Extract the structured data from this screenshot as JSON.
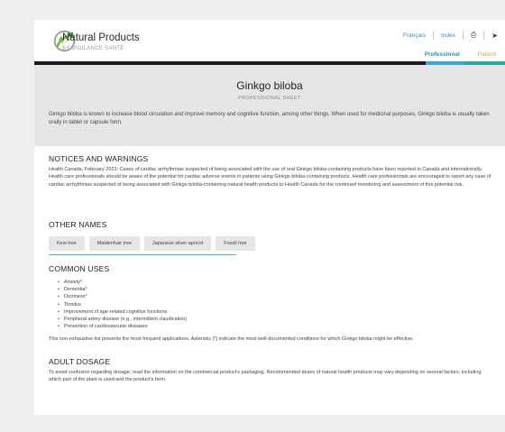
{
  "header": {
    "brand": "Natural Products",
    "tagline": "BY VIGILANCE SANTÉ",
    "links": {
      "language": "Français",
      "index": "Index"
    },
    "tabs": {
      "professional": "Professional",
      "patient": "Patient"
    }
  },
  "hero": {
    "title": "Ginkgo biloba",
    "subtitle": "PROFESSIONAL SHEET",
    "description": "Ginkgo biloba is known to increase blood circulation and improve memory and cognitive function, among other things. When used for medicinal purposes, Ginkgo biloba is usually taken orally in tablet or capsule form."
  },
  "notices": {
    "heading": "NOTICES AND WARNINGS",
    "text": "Health Canada, February 2021: Cases of cardiac arrhythmias suspected of being associated with the use of oral Ginkgo biloba-containing products have been reported in Canada and internationally. Health care professionals should be aware of the potential for cardiac adverse events in patients using Ginkgo biloba-containing products. Health care professionals are encouraged to report any case of cardiac arrhythmias suspected of being associated with Ginkgo biloba-containing natural health products to Health Canada for the continued monitoring and assessment of this potential risk."
  },
  "other_names": {
    "heading": "OTHER NAMES",
    "chips": [
      "Kew tree",
      "Maidenhair tree",
      "Japanese silver apricot",
      "Fossil tree"
    ]
  },
  "common_uses": {
    "heading": "COMMON USES",
    "items": [
      "Anxiety*",
      "Dementia*",
      "Dizziness*",
      "Tinnitus",
      "Improvement of age-related cognitive functions",
      "Peripheral artery disease (e.g., intermittent claudication)",
      "Prevention of cardiovascular diseases"
    ],
    "note": "This non-exhaustive list presents the most frequent applications. Asterisks (*) indicate the most well-documented conditions for which Ginkgo biloba might be effective."
  },
  "adult_dosage": {
    "heading": "ADULT DOSAGE",
    "text": "To avoid confusion regarding dosage, read the information on the commercial product's packaging. Recommended doses of natural health products may vary depending on several factors, including which part of the plant is used and the product's form."
  },
  "icons": {
    "logo": "leaf-arrow-logo",
    "print": "print-icon"
  },
  "colors": {
    "accent_blue": "#2a8fc6",
    "accent_orange": "#e8a23c",
    "hero_bg": "#e6e6e6"
  }
}
